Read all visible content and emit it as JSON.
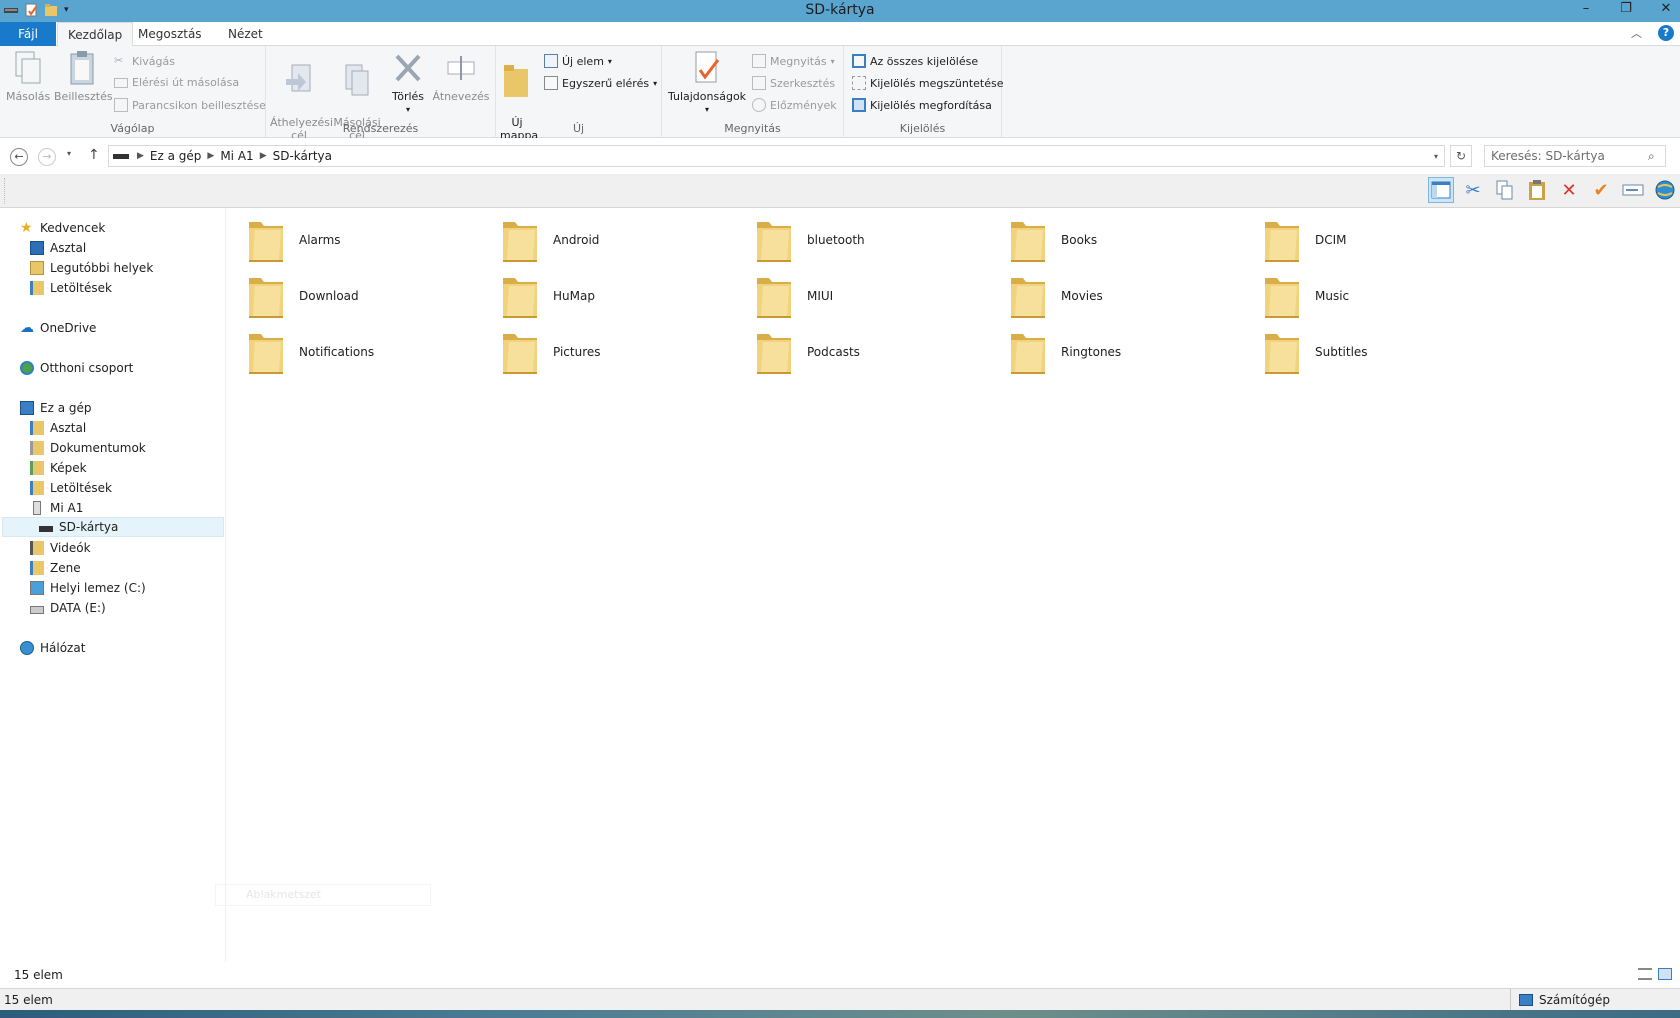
{
  "window": {
    "title": "SD-kártya",
    "min": "–",
    "restore": "❐",
    "close": "✕"
  },
  "ribbon_tabs": {
    "file": "Fájl",
    "home": "Kezdőlap",
    "share": "Megosztás",
    "view": "Nézet",
    "help": "?"
  },
  "clipboard": {
    "group": "Vágólap",
    "copy": "Másolás",
    "paste": "Beillesztés",
    "cut": "Kivágás",
    "copy_path": "Elérési út másolása",
    "paste_shortcut": "Parancsikon beillesztése"
  },
  "organize": {
    "group": "Rendszerezés",
    "move_to": "Áthelyezési\ncél",
    "copy_to": "Másolási\ncél",
    "delete": "Törlés",
    "rename": "Átnevezés"
  },
  "new": {
    "group": "Új",
    "new_folder": "Új\nmappa",
    "new_item": "Új elem",
    "easy_access": "Egyszerű elérés"
  },
  "open": {
    "group": "Megnyitás",
    "properties": "Tulajdonságok",
    "open": "Megnyitás",
    "edit": "Szerkesztés",
    "history": "Előzmények"
  },
  "select": {
    "group": "Kijelölés",
    "select_all": "Az összes kijelölése",
    "select_none": "Kijelölés megszüntetése",
    "invert": "Kijelölés megfordítása"
  },
  "address": {
    "crumbs": [
      "Ez a gép",
      "Mi A1",
      "SD-kártya"
    ],
    "search_placeholder": "Keresés: SD-kártya"
  },
  "nav": {
    "favorites": "Kedvencek",
    "fav_desktop": "Asztal",
    "fav_recent": "Legutóbbi helyek",
    "fav_downloads": "Letöltések",
    "onedrive": "OneDrive",
    "homegroup": "Otthoni csoport",
    "thispc": "Ez a gép",
    "pc_desktop": "Asztal",
    "pc_documents": "Dokumentumok",
    "pc_pictures": "Képek",
    "pc_downloads": "Letöltések",
    "pc_mia1": "Mi A1",
    "pc_sdcard": "SD-kártya",
    "pc_videos": "Videók",
    "pc_music": "Zene",
    "pc_c": "Helyi lemez (C:)",
    "pc_e": "DATA (E:)",
    "network": "Hálózat"
  },
  "folders": [
    "Alarms",
    "Android",
    "bluetooth",
    "Books",
    "DCIM",
    "Download",
    "HuMap",
    "MIUI",
    "Movies",
    "Music",
    "Notifications",
    "Pictures",
    "Podcasts",
    "Ringtones",
    "Subtitles"
  ],
  "ghost_label": "Ablakmetszet",
  "status": {
    "count": "15 elem",
    "count2": "15 elem",
    "computer": "Számítógép"
  },
  "colors": {
    "titlebar": "#5aa5cf",
    "file_tab": "#1979ca",
    "folder": "#e9c667"
  }
}
